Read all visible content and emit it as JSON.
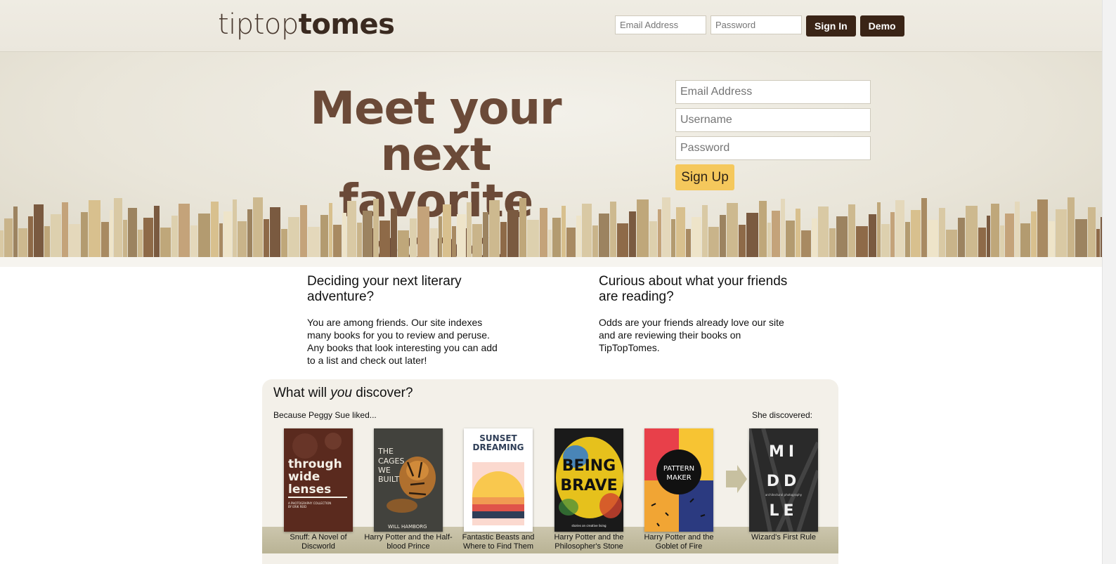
{
  "header": {
    "logo_light": "tiptop",
    "logo_bold": "tomes",
    "login": {
      "email_placeholder": "Email Address",
      "password_placeholder": "Password",
      "sign_in_label": "Sign In",
      "demo_label": "Demo"
    }
  },
  "hero": {
    "headline_line1": "Meet your next",
    "headline_line2": "favorite book.",
    "signup": {
      "email_placeholder": "Email Address",
      "username_placeholder": "Username",
      "password_placeholder": "Password",
      "button_label": "Sign Up"
    }
  },
  "info": {
    "left": {
      "heading": "Deciding your next literary adventure?",
      "body": "You are among friends. Our site indexes many books for you to review and peruse. Any books that look interesting you can add to a list and check out later!"
    },
    "right": {
      "heading": "Curious about what your friends are reading?",
      "body": "Odds are your friends already love our site and are reviewing their books on TipTopTomes."
    }
  },
  "discover": {
    "heading_pre": "What will ",
    "heading_em": "you",
    "heading_post": " discover?",
    "because_label": "Because Peggy Sue liked...",
    "discovered_label": "She discovered:",
    "books": [
      {
        "title": "Snuff: A Novel of Discworld",
        "cover_text": "through wide lenses",
        "cover_sub": "A PHOTOGRAPHY COLLECTION BY ERIK REID"
      },
      {
        "title": "Harry Potter and the Half-blood Prince",
        "cover_text": "THE CAGES WE BUILT",
        "cover_sub": "WILL HAMBORG"
      },
      {
        "title": "Fantastic Beasts and Where to Find Them",
        "cover_text": "SUNSET DREAMING",
        "cover_sub": ""
      },
      {
        "title": "Harry Potter and the Philosopher's Stone",
        "cover_text": "BEING BRAVE",
        "cover_sub": "stories on creative living told from the heart"
      },
      {
        "title": "Harry Potter and the Goblet of Fire",
        "cover_text": "PATTERN MAKER",
        "cover_sub": ""
      },
      {
        "title": "Wizard's First Rule",
        "cover_text": "MI DD LE",
        "cover_sub": "architectural photography"
      }
    ]
  }
}
